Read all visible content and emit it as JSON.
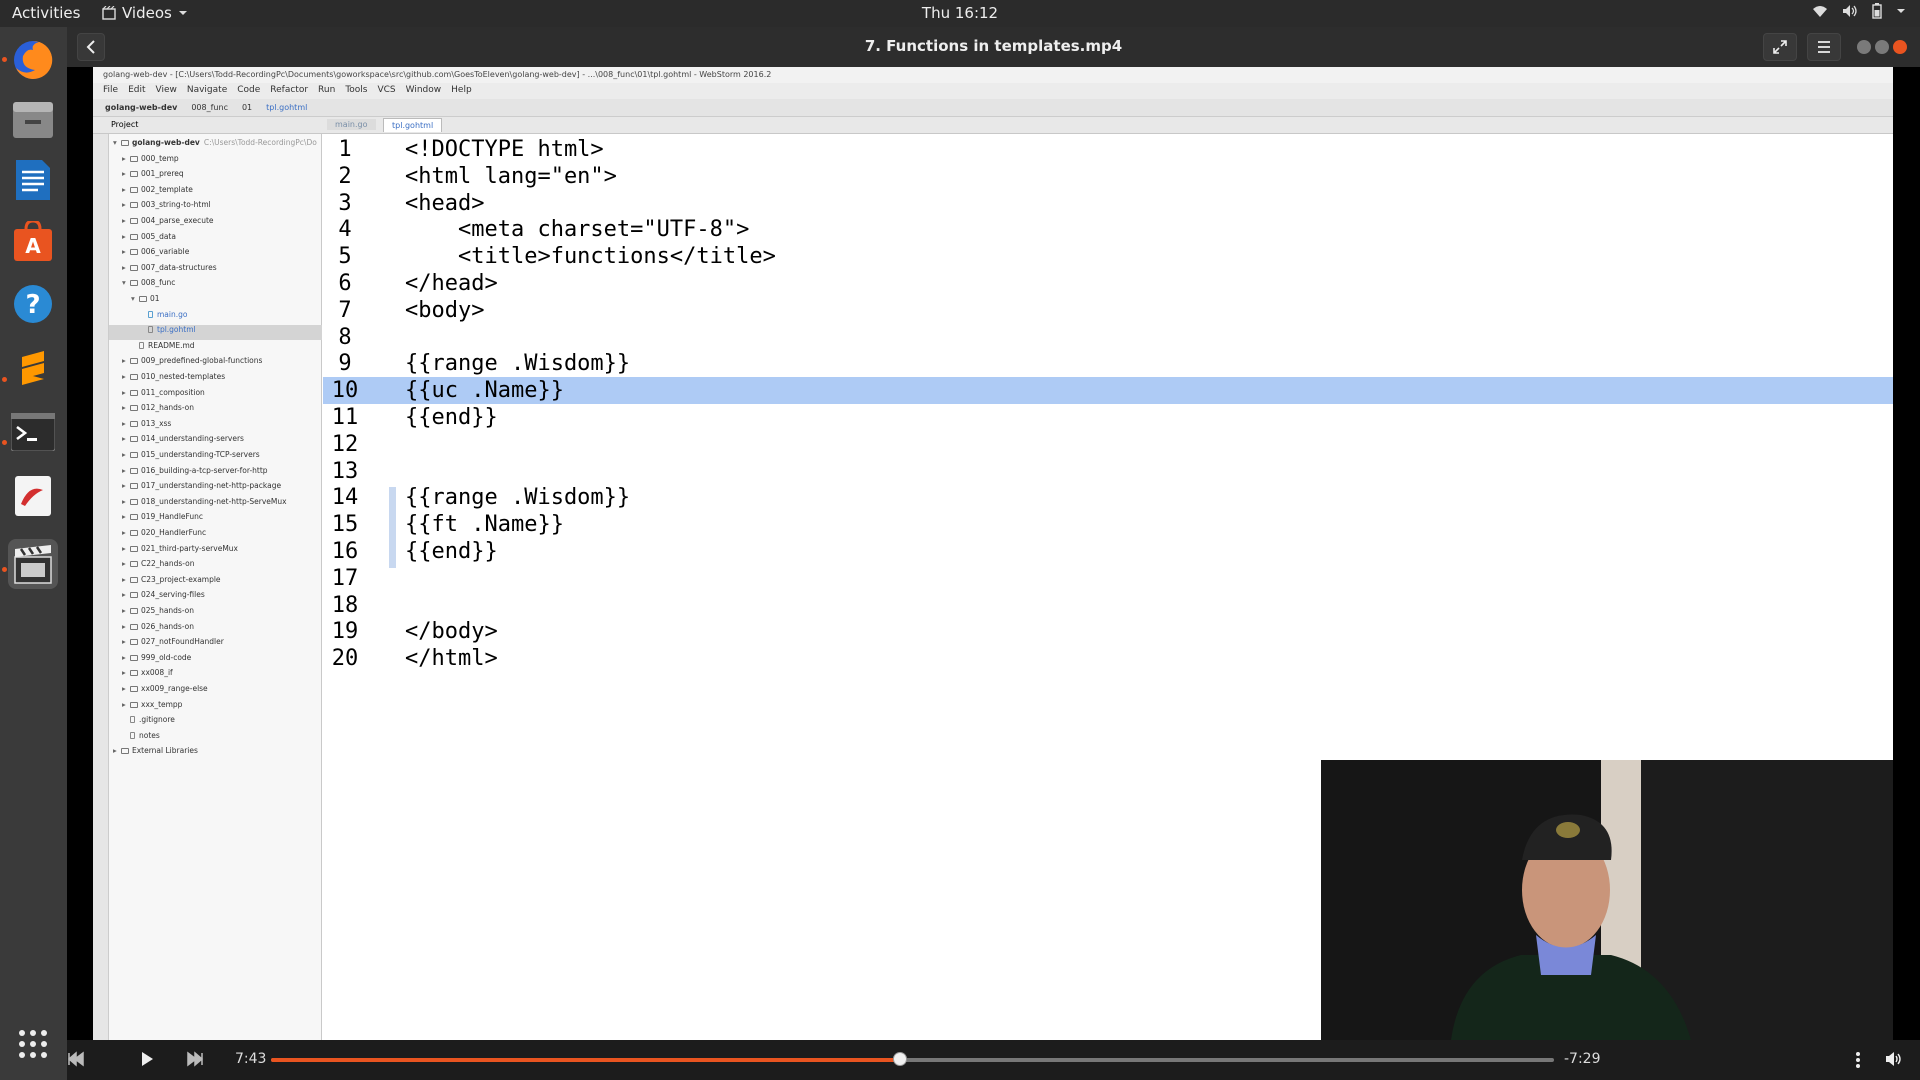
{
  "topbar": {
    "activities": "Activities",
    "app_name": "Videos",
    "clock": "Thu 16:12"
  },
  "dock": {
    "items": [
      "firefox-icon",
      "files-icon",
      "writer-icon",
      "software-icon",
      "help-icon",
      "sublime-icon",
      "terminal-icon",
      "evince-icon",
      "videos-icon"
    ]
  },
  "player": {
    "title": "7. Functions in templates.mp4",
    "elapsed": "7:43",
    "remaining": "-7:29",
    "progress": 0.49
  },
  "ide": {
    "window_title": "golang-web-dev - [C:\\Users\\Todd-RecordingPc\\Documents\\goworkspace\\src\\github.com\\GoesToEleven\\golang-web-dev] - ...\\008_func\\01\\tpl.gohtml - WebStorm 2016.2",
    "menu": [
      "File",
      "Edit",
      "View",
      "Navigate",
      "Code",
      "Refactor",
      "Run",
      "Tools",
      "VCS",
      "Window",
      "Help"
    ],
    "breadcrumbs": [
      "golang-web-dev",
      "008_func",
      "01",
      "tpl.gohtml"
    ],
    "tabs": [
      "main.go",
      "tpl.gohtml"
    ],
    "project_label": "Project",
    "tree": [
      {
        "label": "golang-web-dev",
        "indent": 0,
        "type": "root",
        "note": "C:\\Users\\Todd-RecordingPc\\Do"
      },
      {
        "label": "000_temp",
        "indent": 1,
        "type": "folder"
      },
      {
        "label": "001_prereq",
        "indent": 1,
        "type": "folder"
      },
      {
        "label": "002_template",
        "indent": 1,
        "type": "folder"
      },
      {
        "label": "003_string-to-html",
        "indent": 1,
        "type": "folder"
      },
      {
        "label": "004_parse_execute",
        "indent": 1,
        "type": "folder"
      },
      {
        "label": "005_data",
        "indent": 1,
        "type": "folder"
      },
      {
        "label": "006_variable",
        "indent": 1,
        "type": "folder"
      },
      {
        "label": "007_data-structures",
        "indent": 1,
        "type": "folder"
      },
      {
        "label": "008_func",
        "indent": 1,
        "type": "folder-open"
      },
      {
        "label": "01",
        "indent": 2,
        "type": "folder-open"
      },
      {
        "label": "main.go",
        "indent": 3,
        "type": "file-go"
      },
      {
        "label": "tpl.gohtml",
        "indent": 3,
        "type": "file-sel"
      },
      {
        "label": "README.md",
        "indent": 2,
        "type": "file"
      },
      {
        "label": "009_predefined-global-functions",
        "indent": 1,
        "type": "folder"
      },
      {
        "label": "010_nested-templates",
        "indent": 1,
        "type": "folder"
      },
      {
        "label": "011_composition",
        "indent": 1,
        "type": "folder"
      },
      {
        "label": "012_hands-on",
        "indent": 1,
        "type": "folder"
      },
      {
        "label": "013_xss",
        "indent": 1,
        "type": "folder"
      },
      {
        "label": "014_understanding-servers",
        "indent": 1,
        "type": "folder"
      },
      {
        "label": "015_understanding-TCP-servers",
        "indent": 1,
        "type": "folder"
      },
      {
        "label": "016_building-a-tcp-server-for-http",
        "indent": 1,
        "type": "folder"
      },
      {
        "label": "017_understanding-net-http-package",
        "indent": 1,
        "type": "folder"
      },
      {
        "label": "018_understanding-net-http-ServeMux",
        "indent": 1,
        "type": "folder"
      },
      {
        "label": "019_HandleFunc",
        "indent": 1,
        "type": "folder"
      },
      {
        "label": "020_HandlerFunc",
        "indent": 1,
        "type": "folder"
      },
      {
        "label": "021_third-party-serveMux",
        "indent": 1,
        "type": "folder"
      },
      {
        "label": "C22_hands-on",
        "indent": 1,
        "type": "folder"
      },
      {
        "label": "C23_project-example",
        "indent": 1,
        "type": "folder"
      },
      {
        "label": "024_serving-files",
        "indent": 1,
        "type": "folder"
      },
      {
        "label": "025_hands-on",
        "indent": 1,
        "type": "folder"
      },
      {
        "label": "026_hands-on",
        "indent": 1,
        "type": "folder"
      },
      {
        "label": "027_notFoundHandler",
        "indent": 1,
        "type": "folder"
      },
      {
        "label": "999_old-code",
        "indent": 1,
        "type": "folder"
      },
      {
        "label": "xx008_if",
        "indent": 1,
        "type": "folder"
      },
      {
        "label": "xx009_range-else",
        "indent": 1,
        "type": "folder"
      },
      {
        "label": "xxx_tempp",
        "indent": 1,
        "type": "folder"
      },
      {
        "label": ".gitignore",
        "indent": 1,
        "type": "file"
      },
      {
        "label": "notes",
        "indent": 1,
        "type": "file"
      },
      {
        "label": "External Libraries",
        "indent": 0,
        "type": "lib"
      }
    ],
    "code": [
      "<!DOCTYPE html>",
      "<html lang=\"en\">",
      "<head>",
      "    <meta charset=\"UTF-8\">",
      "    <title>functions</title>",
      "</head>",
      "<body>",
      "",
      "{{range .Wisdom}}",
      "{{uc .Name}}",
      "{{end}}",
      "",
      "",
      "{{range .Wisdom}}",
      "{{ft .Name}}",
      "{{end}}",
      "",
      "",
      "</body>",
      "</html>"
    ],
    "current_line": 10
  }
}
